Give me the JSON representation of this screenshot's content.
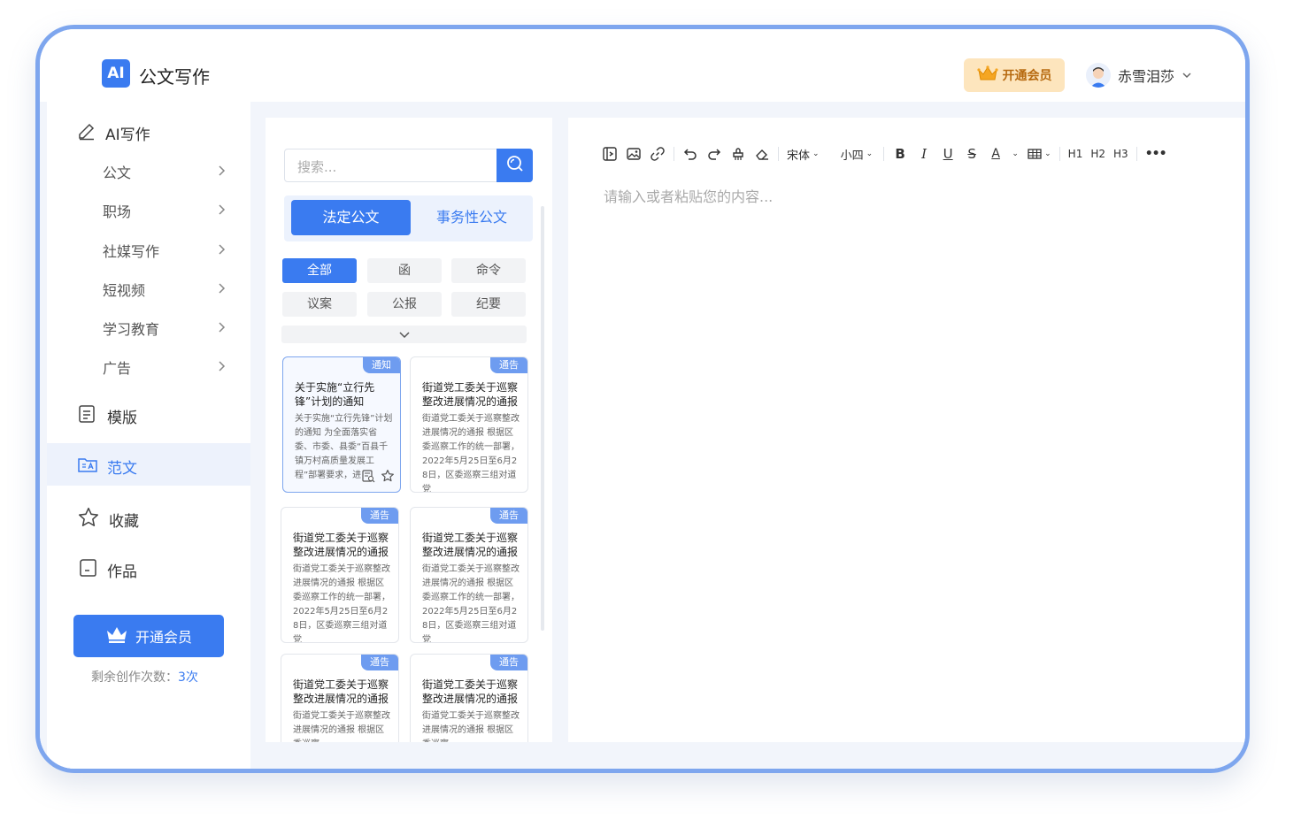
{
  "app": {
    "logo_text": "AI",
    "title": "公文写作"
  },
  "header": {
    "vip_label": "开通会员",
    "user_name": "赤雪泪莎"
  },
  "sidebar": {
    "ai_writing": "AI写作",
    "sub_items": [
      {
        "label": "公文"
      },
      {
        "label": "职场"
      },
      {
        "label": "社媒写作"
      },
      {
        "label": "短视频"
      },
      {
        "label": "学习教育"
      },
      {
        "label": "广告"
      }
    ],
    "templates": "模版",
    "samples": "范文",
    "favorites": "收藏",
    "works": "作品",
    "vip_button": "开通会员",
    "remaining_label": "剩余创作次数：",
    "remaining_count": "3次"
  },
  "list_panel": {
    "search_placeholder": "搜索...",
    "tabs": [
      "法定公文",
      "事务性公文"
    ],
    "active_tab": "法定公文",
    "filters": [
      "全部",
      "函",
      "命令",
      "议案",
      "公报",
      "纪要"
    ],
    "active_filter": "全部",
    "cards": [
      {
        "tag": "通知",
        "title": "关于实施“立行先锋”计划的通知",
        "excerpt": "关于实施“立行先锋”计划的通知 为全面落实省委、市委、县委“百县千镇万村高质量发展工程”部署要求，进"
      },
      {
        "tag": "通告",
        "title": "街道党工委关于巡察整改进展情况的通报",
        "excerpt": "街道党工委关于巡察整改进展情况的通报 根据区委巡察工作的统一部署，2022年5月25日至6月28日，区委巡察三组对道党"
      },
      {
        "tag": "通告",
        "title": "街道党工委关于巡察整改进展情况的通报",
        "excerpt": "街道党工委关于巡察整改进展情况的通报 根据区委巡察工作的统一部署，2022年5月25日至6月28日，区委巡察三组对道党"
      },
      {
        "tag": "通告",
        "title": "街道党工委关于巡察整改进展情况的通报",
        "excerpt": "街道党工委关于巡察整改进展情况的通报 根据区委巡察工作的统一部署，2022年5月25日至6月28日，区委巡察三组对道党"
      },
      {
        "tag": "通告",
        "title": "街道党工委关于巡察整改进展情况的通报",
        "excerpt": "街道党工委关于巡察整改进展情况的通报 根据区委巡察"
      },
      {
        "tag": "通告",
        "title": "街道党工委关于巡察整改进展情况的通报",
        "excerpt": "街道党工委关于巡察整改进展情况的通报 根据区委巡察"
      }
    ]
  },
  "editor": {
    "font_family": "宋体",
    "font_size": "小四",
    "bold_label": "B",
    "italic_label": "I",
    "underline_label": "U",
    "strike_label": "S",
    "color_label": "A",
    "h1": "H1",
    "h2": "H2",
    "h3": "H3",
    "more": "•••",
    "placeholder": "请输入或者粘贴您的内容..."
  }
}
